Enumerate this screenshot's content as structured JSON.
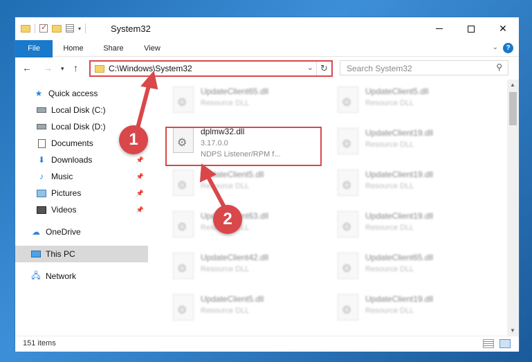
{
  "window": {
    "title": "System32"
  },
  "ribbon": {
    "tabs": [
      "File",
      "Home",
      "Share",
      "View"
    ],
    "help": "?"
  },
  "address_bar": {
    "path": "C:\\Windows\\System32",
    "refresh_glyph": "↻"
  },
  "search": {
    "placeholder": "Search System32"
  },
  "sidebar": {
    "items": [
      {
        "label": "Quick access",
        "icon": "star-icon"
      },
      {
        "label": "Local Disk (C:)",
        "icon": "drive-icon"
      },
      {
        "label": "Local Disk (D:)",
        "icon": "drive-icon"
      },
      {
        "label": "Documents",
        "icon": "documents-icon"
      },
      {
        "label": "Downloads",
        "icon": "download-icon"
      },
      {
        "label": "Music",
        "icon": "music-icon"
      },
      {
        "label": "Pictures",
        "icon": "pictures-icon"
      },
      {
        "label": "Videos",
        "icon": "videos-icon"
      },
      {
        "label": "OneDrive",
        "icon": "cloud-icon"
      },
      {
        "label": "This PC",
        "icon": "computer-icon"
      },
      {
        "label": "Network",
        "icon": "network-icon"
      }
    ]
  },
  "files": [
    {
      "name": "UpdateClient65.dll",
      "desc": "Resource DLL"
    },
    {
      "name": "UpdateClient5.dll",
      "desc": "Resource DLL"
    },
    {
      "name": "dplmw32.dll",
      "desc": "3.17.0.0",
      "desc2": "NDPS Listener/RPM f..."
    },
    {
      "name": "UpdateClient19.dll",
      "desc": "Resource DLL"
    },
    {
      "name": "UpdateClient5.dll",
      "desc": "Resource DLL"
    },
    {
      "name": "UpdateClient19.dll",
      "desc": "Resource DLL"
    },
    {
      "name": "UpdateClient63.dll",
      "desc": "Resource DLL"
    },
    {
      "name": "UpdateClient19.dll",
      "desc": "Resource DLL"
    },
    {
      "name": "UpdateClient42.dll",
      "desc": "Resource DLL"
    },
    {
      "name": "UpdateClient65.dll",
      "desc": "Resource DLL"
    },
    {
      "name": "UpdateClient5.dll",
      "desc": "Resource DLL"
    },
    {
      "name": "UpdateClient19.dll",
      "desc": "Resource DLL"
    }
  ],
  "status": {
    "item_count": "151 items"
  },
  "annotations": {
    "badge1": "1",
    "badge2": "2",
    "color": "#d9474a"
  }
}
